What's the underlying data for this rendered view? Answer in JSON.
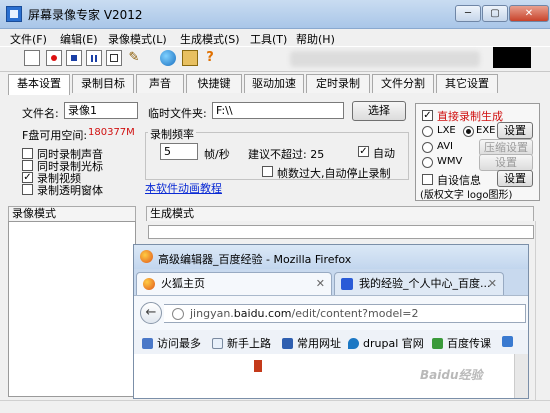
{
  "window": {
    "title": "屏幕录像专家 V2012"
  },
  "menu": [
    "文件(F)",
    "编辑(E)",
    "录像模式(L)",
    "生成模式(S)",
    "工具(T)",
    "帮助(H)"
  ],
  "toolbar": {
    "icons": [
      "new-document-icon",
      "record-icon",
      "stop-icon",
      "pause-icon",
      "frame-icon",
      "pen-icon",
      "globe-icon",
      "film-icon",
      "help-icon"
    ]
  },
  "tabs": [
    "基本设置",
    "录制目标",
    "声音",
    "快捷键",
    "驱动加速",
    "定时录制",
    "文件分割",
    "其它设置"
  ],
  "settings": {
    "filename_label": "文件名:",
    "filename_value": "录像1",
    "tempfolder_label": "临时文件夹:",
    "tempfolder_value": "F:\\\\",
    "select_button": "选择",
    "disk_space_label": "F盘可用空间:",
    "disk_space_value": "180377M",
    "record_sound": "同时录制声音",
    "record_cursor": "同时录制光标",
    "record_video": "录制视频",
    "record_transparent": "录制透明窗体",
    "framerate_title": "录制频率",
    "framerate_value": "5",
    "framerate_unit": "帧/秒",
    "suggest_label": "建议不超过: 25",
    "auto_label": "自动",
    "auto_stop": "帧数过大,自动停止录制",
    "tutorial_link": "本软件动画教程"
  },
  "right_panel": {
    "direct_generate": "直接录制生成",
    "lxe": "LXE",
    "exe": "EXE",
    "avi": "AVI",
    "wmv": "WMV",
    "settings_btn": "设置",
    "compress_btn": "压缩设置",
    "settings_btn2": "设置",
    "custom_info": "自设信息",
    "settings_btn3": "设置",
    "note": "(版权文字 logo图形)"
  },
  "bottom_tabs": {
    "record_mode": "录像模式",
    "generate_mode": "生成模式"
  },
  "firefox": {
    "title": "高级编辑器_百度经验 - Mozilla Firefox",
    "tab1": "火狐主页",
    "tab2": "我的经验_个人中心_百度...",
    "url_prefix": "jingyan.",
    "url_domain": "baidu.com",
    "url_path": "/edit/content?model=2",
    "bookmarks": [
      "访问最多",
      "新手上路",
      "常用网址",
      "drupal 官网",
      "百度传课"
    ]
  },
  "watermark": "Baidu经验"
}
